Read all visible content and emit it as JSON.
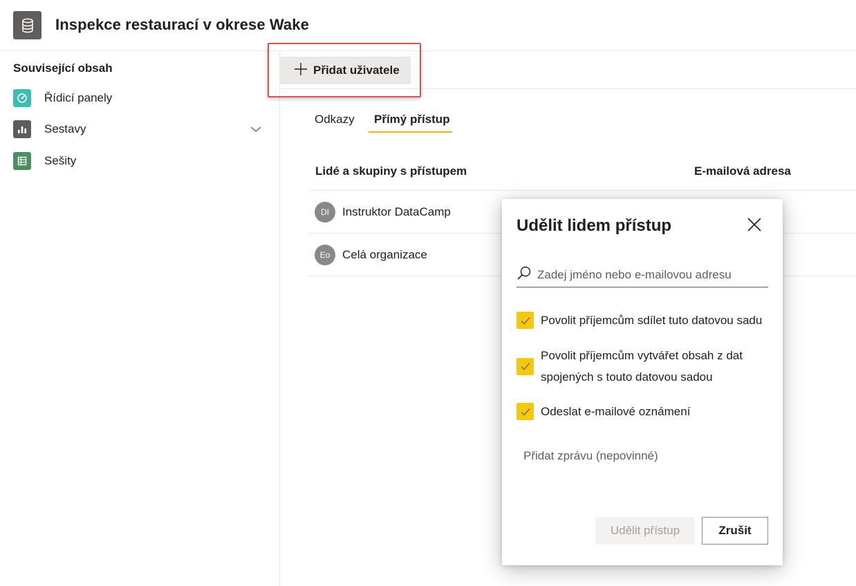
{
  "header": {
    "title": "Inspekce restaurací v okrese Wake",
    "icon": "database-icon"
  },
  "sidebar": {
    "heading": "Související obsah",
    "items": [
      {
        "label": "Řídicí panely",
        "icon": "dashboard-icon",
        "color": "#3dbcb4"
      },
      {
        "label": "Sestavy",
        "icon": "report-icon",
        "color": "#605e5c"
      },
      {
        "label": "Sešity",
        "icon": "workbook-icon",
        "color": "#4b8e5f"
      }
    ]
  },
  "toolbar": {
    "add_user_label": "Přidat uživatele"
  },
  "tabs": [
    {
      "label": "Odkazy",
      "active": false
    },
    {
      "label": "Přímý přístup",
      "active": true
    }
  ],
  "table": {
    "columns": [
      "Lidé a skupiny s přístupem",
      "E-mailová adresa"
    ],
    "rows": [
      {
        "initials": "DI",
        "name": "Instruktor DataCamp"
      },
      {
        "initials": "Eo",
        "name": "Celá organizace"
      }
    ]
  },
  "dialog": {
    "title": "Udělit lidem přístup",
    "search_placeholder": "Zadej jméno nebo e-mailovou adresu",
    "checkboxes": [
      {
        "line1": "Povolit příjemcům sdílet tuto datovou sadu",
        "checked": true
      },
      {
        "line1": "Povolit příjemcům vytvářet obsah z dat",
        "line2": "spojených s touto datovou sadou",
        "checked": true
      },
      {
        "line1": "Odeslat e-mailové oznámení",
        "checked": true
      }
    ],
    "message_placeholder": "Přidat zprávu (nepovinné)",
    "grant_label": "Udělit přístup",
    "cancel_label": "Zrušit"
  },
  "colors": {
    "accent": "#f2c811",
    "tab_underline": "#e8b317",
    "highlight": "#d9534f"
  }
}
